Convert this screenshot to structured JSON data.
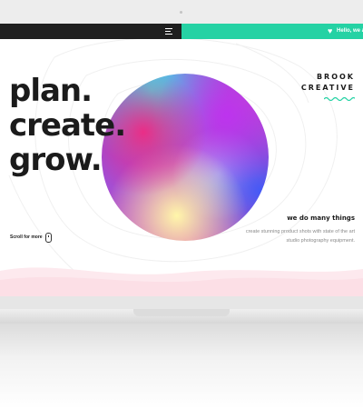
{
  "header": {
    "menu_icon": "hamburger-menu-icon",
    "ticker_icon": "heart-icon",
    "ticker_text": "Hello, we ar"
  },
  "hero": {
    "lines": [
      "plan.",
      "create.",
      "grow."
    ]
  },
  "brand": {
    "line1": "BROOK",
    "line2": "CREATIVE"
  },
  "tagline": {
    "title": "we do many things",
    "text": "create stunning product shots with state of the art studio photography equipment."
  },
  "scroll": {
    "label": "Scroll for more",
    "icon": "mouse-icon"
  },
  "colors": {
    "accent": "#25d2a4",
    "dark": "#1f1f1f",
    "text": "#1b1b1b"
  }
}
